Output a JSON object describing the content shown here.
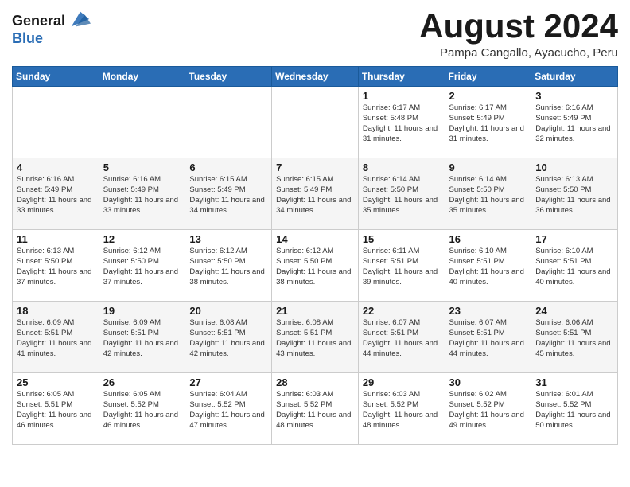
{
  "logo": {
    "general": "General",
    "blue": "Blue"
  },
  "title": {
    "month_year": "August 2024",
    "location": "Pampa Cangallo, Ayacucho, Peru"
  },
  "days_of_week": [
    "Sunday",
    "Monday",
    "Tuesday",
    "Wednesday",
    "Thursday",
    "Friday",
    "Saturday"
  ],
  "weeks": [
    [
      {
        "day": "",
        "info": ""
      },
      {
        "day": "",
        "info": ""
      },
      {
        "day": "",
        "info": ""
      },
      {
        "day": "",
        "info": ""
      },
      {
        "day": "1",
        "info": "Sunrise: 6:17 AM\nSunset: 5:48 PM\nDaylight: 11 hours and 31 minutes."
      },
      {
        "day": "2",
        "info": "Sunrise: 6:17 AM\nSunset: 5:49 PM\nDaylight: 11 hours and 31 minutes."
      },
      {
        "day": "3",
        "info": "Sunrise: 6:16 AM\nSunset: 5:49 PM\nDaylight: 11 hours and 32 minutes."
      }
    ],
    [
      {
        "day": "4",
        "info": "Sunrise: 6:16 AM\nSunset: 5:49 PM\nDaylight: 11 hours and 33 minutes."
      },
      {
        "day": "5",
        "info": "Sunrise: 6:16 AM\nSunset: 5:49 PM\nDaylight: 11 hours and 33 minutes."
      },
      {
        "day": "6",
        "info": "Sunrise: 6:15 AM\nSunset: 5:49 PM\nDaylight: 11 hours and 34 minutes."
      },
      {
        "day": "7",
        "info": "Sunrise: 6:15 AM\nSunset: 5:49 PM\nDaylight: 11 hours and 34 minutes."
      },
      {
        "day": "8",
        "info": "Sunrise: 6:14 AM\nSunset: 5:50 PM\nDaylight: 11 hours and 35 minutes."
      },
      {
        "day": "9",
        "info": "Sunrise: 6:14 AM\nSunset: 5:50 PM\nDaylight: 11 hours and 35 minutes."
      },
      {
        "day": "10",
        "info": "Sunrise: 6:13 AM\nSunset: 5:50 PM\nDaylight: 11 hours and 36 minutes."
      }
    ],
    [
      {
        "day": "11",
        "info": "Sunrise: 6:13 AM\nSunset: 5:50 PM\nDaylight: 11 hours and 37 minutes."
      },
      {
        "day": "12",
        "info": "Sunrise: 6:12 AM\nSunset: 5:50 PM\nDaylight: 11 hours and 37 minutes."
      },
      {
        "day": "13",
        "info": "Sunrise: 6:12 AM\nSunset: 5:50 PM\nDaylight: 11 hours and 38 minutes."
      },
      {
        "day": "14",
        "info": "Sunrise: 6:12 AM\nSunset: 5:50 PM\nDaylight: 11 hours and 38 minutes."
      },
      {
        "day": "15",
        "info": "Sunrise: 6:11 AM\nSunset: 5:51 PM\nDaylight: 11 hours and 39 minutes."
      },
      {
        "day": "16",
        "info": "Sunrise: 6:10 AM\nSunset: 5:51 PM\nDaylight: 11 hours and 40 minutes."
      },
      {
        "day": "17",
        "info": "Sunrise: 6:10 AM\nSunset: 5:51 PM\nDaylight: 11 hours and 40 minutes."
      }
    ],
    [
      {
        "day": "18",
        "info": "Sunrise: 6:09 AM\nSunset: 5:51 PM\nDaylight: 11 hours and 41 minutes."
      },
      {
        "day": "19",
        "info": "Sunrise: 6:09 AM\nSunset: 5:51 PM\nDaylight: 11 hours and 42 minutes."
      },
      {
        "day": "20",
        "info": "Sunrise: 6:08 AM\nSunset: 5:51 PM\nDaylight: 11 hours and 42 minutes."
      },
      {
        "day": "21",
        "info": "Sunrise: 6:08 AM\nSunset: 5:51 PM\nDaylight: 11 hours and 43 minutes."
      },
      {
        "day": "22",
        "info": "Sunrise: 6:07 AM\nSunset: 5:51 PM\nDaylight: 11 hours and 44 minutes."
      },
      {
        "day": "23",
        "info": "Sunrise: 6:07 AM\nSunset: 5:51 PM\nDaylight: 11 hours and 44 minutes."
      },
      {
        "day": "24",
        "info": "Sunrise: 6:06 AM\nSunset: 5:51 PM\nDaylight: 11 hours and 45 minutes."
      }
    ],
    [
      {
        "day": "25",
        "info": "Sunrise: 6:05 AM\nSunset: 5:51 PM\nDaylight: 11 hours and 46 minutes."
      },
      {
        "day": "26",
        "info": "Sunrise: 6:05 AM\nSunset: 5:52 PM\nDaylight: 11 hours and 46 minutes."
      },
      {
        "day": "27",
        "info": "Sunrise: 6:04 AM\nSunset: 5:52 PM\nDaylight: 11 hours and 47 minutes."
      },
      {
        "day": "28",
        "info": "Sunrise: 6:03 AM\nSunset: 5:52 PM\nDaylight: 11 hours and 48 minutes."
      },
      {
        "day": "29",
        "info": "Sunrise: 6:03 AM\nSunset: 5:52 PM\nDaylight: 11 hours and 48 minutes."
      },
      {
        "day": "30",
        "info": "Sunrise: 6:02 AM\nSunset: 5:52 PM\nDaylight: 11 hours and 49 minutes."
      },
      {
        "day": "31",
        "info": "Sunrise: 6:01 AM\nSunset: 5:52 PM\nDaylight: 11 hours and 50 minutes."
      }
    ]
  ]
}
